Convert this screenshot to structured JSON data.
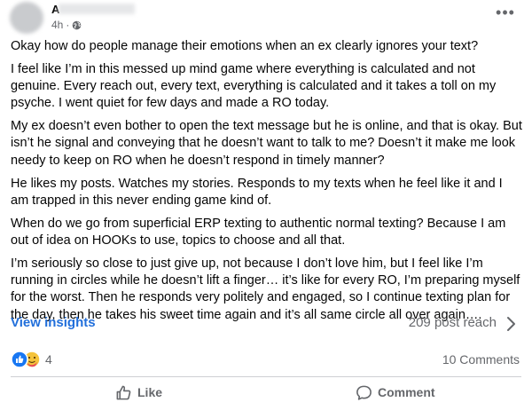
{
  "post": {
    "author_initial": "A",
    "timestamp": "4h",
    "privacy_icon": "globe-icon",
    "more_label": "•••",
    "paragraphs": [
      "Okay how do people manage their emotions when an ex clearly ignores your text?",
      "I feel like I’m in this messed up mind game where everything is calculated and not genuine. Every reach out, every text, everything is calculated and it takes a toll on my psyche. I went quiet for few days and made a RO today.",
      "My ex doesn’t even bother to open the text message but he is online, and that is okay. But isn’t he signal and conveying that he doesn’t want to talk to me? Doesn’t it make me look needy to keep on RO when he doesn’t respond in timely manner?",
      "He likes my posts. Watches my stories. Responds to my texts when he feel like it and I am trapped in this never ending game kind of.",
      "When do we go from superficial ERP texting to authentic normal texting? Because I am out of idea on HOOKs to use, topics to choose and all that.",
      "I’m seriously so close to just give up, not because I don’t love him, but I feel like I’m running in circles while he doesn’t lift a finger… it’s like for every RO, I’m preparing myself for the worst. Then he responds very politely and engaged, so I continue texting plan for the day, then he takes his sweet time again and it’s all same circle all over again…."
    ]
  },
  "insights": {
    "view_label": "View insights",
    "reach_label": "209 post reach",
    "accent_color": "#216fdb"
  },
  "reactions": {
    "icons": [
      "like-icon",
      "care-icon"
    ],
    "count": "4",
    "comments_label": "10 Comments"
  },
  "actions": {
    "like_label": "Like",
    "comment_label": "Comment"
  }
}
